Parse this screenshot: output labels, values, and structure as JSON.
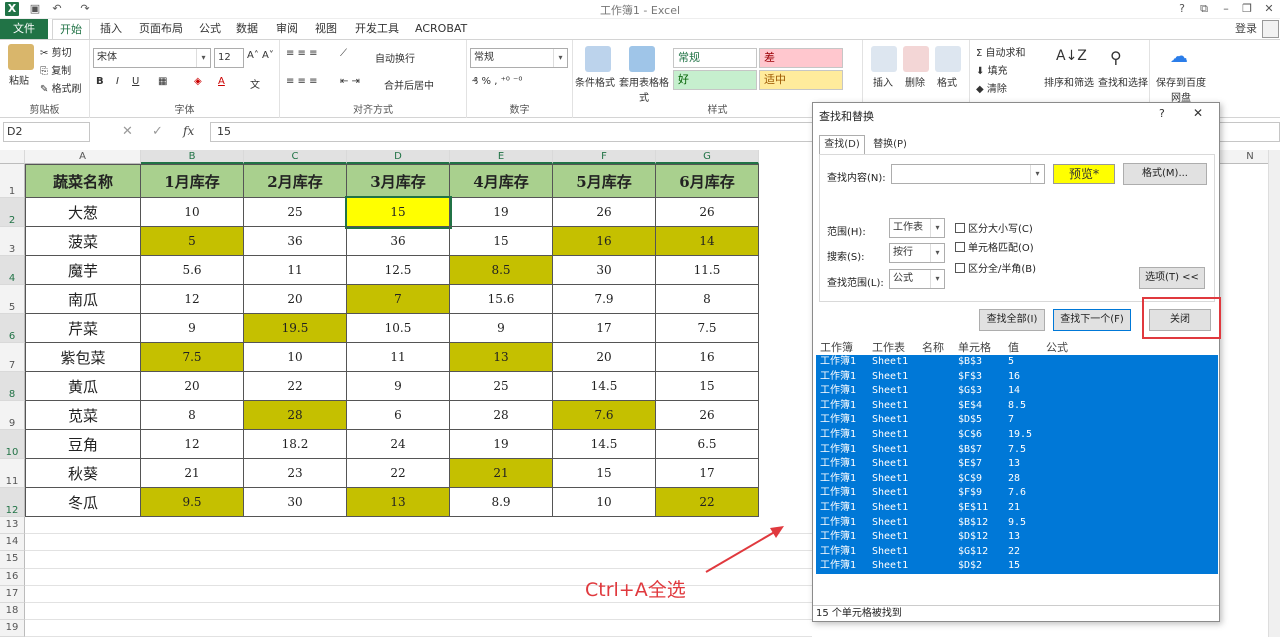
{
  "window": {
    "title": "工作簿1 - Excel",
    "login": "登录"
  },
  "tabs": [
    "文件",
    "开始",
    "插入",
    "页面布局",
    "公式",
    "数据",
    "审阅",
    "视图",
    "开发工具",
    "ACROBAT"
  ],
  "ribbon": {
    "clipboard": {
      "paste": "粘贴",
      "cut": "剪切",
      "copy": "复制",
      "format_painter": "格式刷",
      "label": "剪贴板"
    },
    "font": {
      "name": "宋体",
      "size": "12",
      "label": "字体"
    },
    "align": {
      "wrap": "自动换行",
      "merge": "合并后居中",
      "label": "对齐方式"
    },
    "number": {
      "format": "常规",
      "label": "数字"
    },
    "styles": {
      "cond": "条件格式",
      "table": "套用表格格式",
      "normal": "常规",
      "bad": "差",
      "good": "好",
      "neutral": "适中",
      "label": "样式"
    },
    "cells": {
      "insert": "插入",
      "delete": "删除",
      "format": "格式"
    },
    "edit": {
      "autosum": "自动求和",
      "fill": "填充",
      "clear": "清除",
      "sort": "排序和筛选",
      "find": "查找和选择"
    },
    "save": {
      "label": "保存到百度网盘"
    }
  },
  "formula": {
    "namebox": "D2",
    "fx": "fx",
    "value": "15"
  },
  "columns": [
    "A",
    "B",
    "C",
    "D",
    "E",
    "F",
    "G"
  ],
  "right_col": "N",
  "headers": [
    "蔬菜名称",
    "1月库存",
    "2月库存",
    "3月库存",
    "4月库存",
    "5月库存",
    "6月库存"
  ],
  "rows": [
    [
      "大葱",
      "10",
      "25",
      "15",
      "19",
      "26",
      "26"
    ],
    [
      "菠菜",
      "5",
      "36",
      "36",
      "15",
      "16",
      "14"
    ],
    [
      "魔芋",
      "5.6",
      "11",
      "12.5",
      "8.5",
      "30",
      "11.5"
    ],
    [
      "南瓜",
      "12",
      "20",
      "7",
      "15.6",
      "7.9",
      "8"
    ],
    [
      "芹菜",
      "9",
      "19.5",
      "10.5",
      "9",
      "17",
      "7.5"
    ],
    [
      "紫包菜",
      "7.5",
      "10",
      "11",
      "13",
      "20",
      "16"
    ],
    [
      "黄瓜",
      "20",
      "22",
      "9",
      "25",
      "14.5",
      "15"
    ],
    [
      "苋菜",
      "8",
      "28",
      "6",
      "28",
      "7.6",
      "26"
    ],
    [
      "豆角",
      "12",
      "18.2",
      "24",
      "19",
      "14.5",
      "6.5"
    ],
    [
      "秋葵",
      "21",
      "23",
      "22",
      "21",
      "15",
      "17"
    ],
    [
      "冬瓜",
      "9.5",
      "30",
      "13",
      "8.9",
      "10",
      "22"
    ]
  ],
  "row_numbers": [
    "1",
    "2",
    "3",
    "4",
    "5",
    "6",
    "7",
    "8",
    "9",
    "10",
    "11",
    "12",
    "13",
    "14",
    "15",
    "16",
    "17",
    "18",
    "19"
  ],
  "dialog": {
    "title": "查找和替换",
    "help": "?",
    "close_x": "✕",
    "tab_find": "查找(D)",
    "tab_replace": "替换(P)",
    "find_label": "查找内容(N):",
    "preview": "预览*",
    "format_btn": "格式(M)...",
    "within_label": "范围(H):",
    "within_val": "工作表",
    "search_label": "搜索(S):",
    "search_val": "按行",
    "lookin_label": "查找范围(L):",
    "lookin_val": "公式",
    "match_case": "区分大小写(C)",
    "match_cell": "单元格匹配(O)",
    "match_width": "区分全/半角(B)",
    "options_btn": "选项(T) <<",
    "find_all": "查找全部(I)",
    "find_next": "查找下一个(F)",
    "close_btn": "关闭",
    "result_headers": [
      "工作簿",
      "工作表",
      "名称",
      "单元格",
      "值",
      "公式"
    ],
    "results": [
      [
        "工作簿1",
        "Sheet1",
        "",
        "$B$3",
        "5"
      ],
      [
        "工作簿1",
        "Sheet1",
        "",
        "$F$3",
        "16"
      ],
      [
        "工作簿1",
        "Sheet1",
        "",
        "$G$3",
        "14"
      ],
      [
        "工作簿1",
        "Sheet1",
        "",
        "$E$4",
        "8.5"
      ],
      [
        "工作簿1",
        "Sheet1",
        "",
        "$D$5",
        "7"
      ],
      [
        "工作簿1",
        "Sheet1",
        "",
        "$C$6",
        "19.5"
      ],
      [
        "工作簿1",
        "Sheet1",
        "",
        "$B$7",
        "7.5"
      ],
      [
        "工作簿1",
        "Sheet1",
        "",
        "$E$7",
        "13"
      ],
      [
        "工作簿1",
        "Sheet1",
        "",
        "$C$9",
        "28"
      ],
      [
        "工作簿1",
        "Sheet1",
        "",
        "$F$9",
        "7.6"
      ],
      [
        "工作簿1",
        "Sheet1",
        "",
        "$E$11",
        "21"
      ],
      [
        "工作簿1",
        "Sheet1",
        "",
        "$B$12",
        "9.5"
      ],
      [
        "工作簿1",
        "Sheet1",
        "",
        "$D$12",
        "13"
      ],
      [
        "工作簿1",
        "Sheet1",
        "",
        "$G$12",
        "22"
      ],
      [
        "工作簿1",
        "Sheet1",
        "",
        "$D$2",
        "15"
      ]
    ],
    "status": "15 个单元格被找到"
  },
  "annotation": "Ctrl+A全选",
  "highlight": {
    "olive": "#c5c000",
    "yellow": "#ffff00",
    "header_green": "#a9d08e",
    "select_blue": "#0078d7",
    "annot_red": "#e0393e"
  },
  "highlighted_cells": [
    "B3",
    "F3",
    "G3",
    "E4",
    "D5",
    "C6",
    "B7",
    "E7",
    "C9",
    "F9",
    "E11",
    "B12",
    "D12",
    "G12"
  ],
  "yellow_cell": "D2"
}
